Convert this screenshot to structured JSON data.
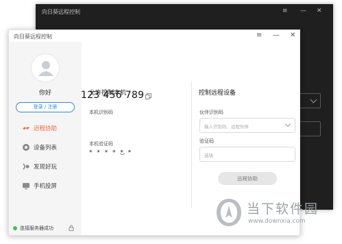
{
  "back_window": {
    "title": "向日葵远程控制",
    "controls": {
      "menu": "≡",
      "minimize": "—",
      "close": "✕"
    }
  },
  "window": {
    "title": "向日葵远程控制",
    "controls": {
      "menu": "≡",
      "minimize": "—",
      "close": "✕"
    }
  },
  "sidebar": {
    "greeting": "你好",
    "login_label": "登录 / 注册",
    "items": [
      {
        "label": "远程协助",
        "icon": "remote-assist-icon",
        "active": true
      },
      {
        "label": "设备列表",
        "icon": "device-list-icon",
        "active": false
      },
      {
        "label": "发现好玩",
        "icon": "discover-icon",
        "active": false
      },
      {
        "label": "手机投屏",
        "icon": "screen-cast-icon",
        "active": false
      }
    ],
    "status": "连接服务器成功"
  },
  "allow": {
    "heading": "允许控制本机",
    "id_label": "本机识别码",
    "id_value": "123 456 789",
    "code_label": "本机验证码",
    "code_value": "* * * * * *"
  },
  "control": {
    "heading": "控制远程设备",
    "partner_label": "伙伴识别码",
    "partner_placeholder": "输入识别码、远程伙伴",
    "code_label": "验证码",
    "code_placeholder": "选填",
    "connect_label": "远程协助"
  },
  "watermark": {
    "brand": "当下软件园",
    "url": "www.downxia.com"
  },
  "colors": {
    "accent_orange": "#f06a3c",
    "accent_blue": "#2f83e8",
    "status_green": "#3ec34b",
    "dark_bg": "#1f1f1f"
  }
}
